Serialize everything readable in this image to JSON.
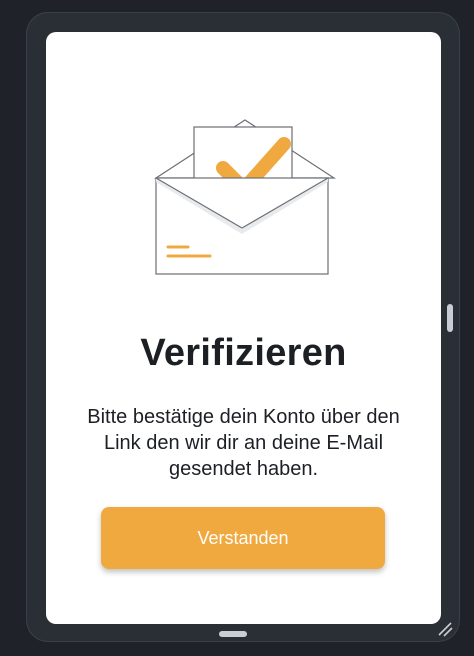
{
  "dialog": {
    "title": "Verifizieren",
    "message": "Bitte bestätige dein Konto über den Link den wir dir an deine E-Mail gesendet haben.",
    "confirm_label": "Verstanden"
  },
  "illustration": {
    "icon": "envelope-check-icon",
    "accent_color": "#f0a93e"
  },
  "colors": {
    "accent": "#f0a93e",
    "frame": "#2a2f36",
    "background": "#1f2329",
    "text": "#1c1f24"
  }
}
